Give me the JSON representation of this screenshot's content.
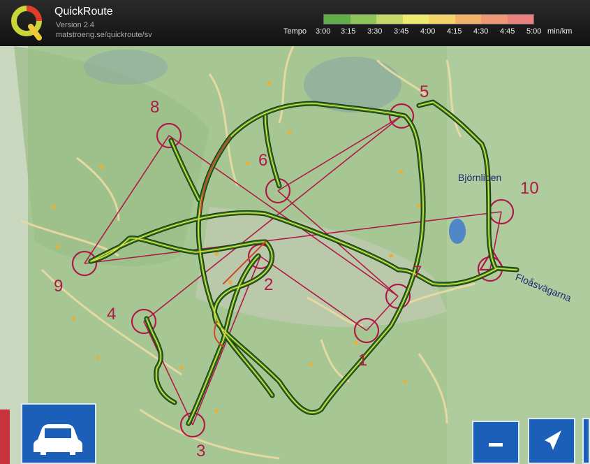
{
  "app": {
    "title": "QuickRoute",
    "version": "Version 2.4",
    "url": "matstroeng.se/quickroute/sv"
  },
  "tempo_scale": {
    "label": "Tempo",
    "ticks": [
      "3:00",
      "3:15",
      "3:30",
      "3:45",
      "4:00",
      "4:15",
      "4:30",
      "4:45",
      "5:00"
    ],
    "unit": "min/km",
    "colors": [
      "#5fae4a",
      "#8fc45a",
      "#c6d86a",
      "#ecea70",
      "#f4d36b",
      "#f2b26a",
      "#ee9774",
      "#ea8080"
    ]
  },
  "map": {
    "controls": [
      "1",
      "2",
      "3",
      "4",
      "5",
      "6",
      "7",
      "8",
      "9",
      "10"
    ],
    "place_names": [
      "Björnliden",
      "Floåsvägarna"
    ],
    "course_color": "#b01a49",
    "route_colors": [
      "#2d7a22",
      "#e0d94a",
      "#d2452f"
    ]
  }
}
